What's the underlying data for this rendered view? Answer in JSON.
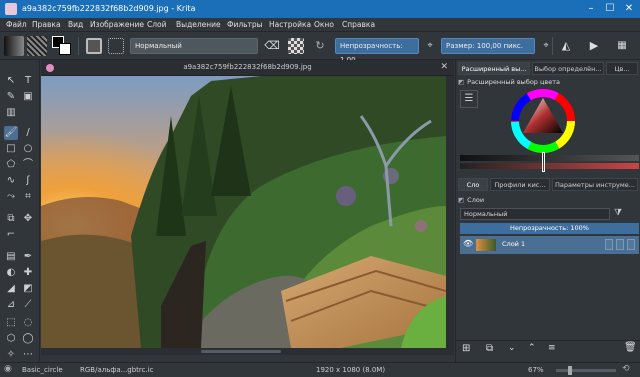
{
  "window": {
    "title": "a9a382c759fb222832f68b2d909.jpg - Krita"
  },
  "menu": [
    "Файл",
    "Правка",
    "Вид",
    "Изображение",
    "Слой",
    "Выделение",
    "Фильтры",
    "Настройка",
    "Окно",
    "Справка"
  ],
  "toolbar": {
    "blend_mode": "Нормальный",
    "opacity_label": "Непрозрачность: 1,00",
    "size_label": "Размер: 100,00 пикс."
  },
  "document": {
    "tab_title": "a9a382c759fb222832f68b2d909.jpg"
  },
  "dock": {
    "top_tabs": [
      "Расширенный вы...",
      "Выбор определён...",
      "Цв..."
    ],
    "color_panel_title": "Расширенный выбор цвета",
    "mid_tabs": [
      "Сло",
      "Профили кис...",
      "Параметры инструме..."
    ],
    "layers_title": "Слои",
    "layers_blend": "Нормальный",
    "layers_opacity": "Непрозрачность: 100%",
    "layer_name": "Слой 1"
  },
  "status": {
    "brush": "Basic_circle",
    "colorspace": "RGB/альфа...gbtrc.ic",
    "dimensions": "1920 x 1080 (8.0M)",
    "zoom": "67%"
  },
  "colors": {
    "accent": "#1b6fb8",
    "selection": "#4b6f93",
    "bg": "#31363b"
  }
}
